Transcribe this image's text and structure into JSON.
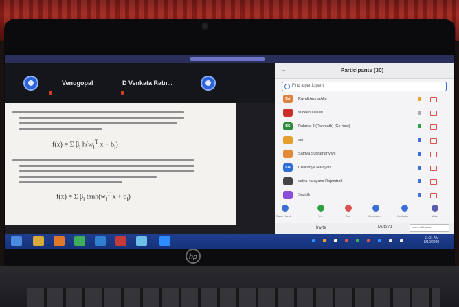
{
  "video_strip": {
    "names": [
      "Venugopal",
      "D Venkata Ratn..."
    ]
  },
  "participants": {
    "title": "Participants (30)",
    "search_placeholder": "Find a participant",
    "rows": [
      {
        "initials": "RA",
        "name": "Ravali Aruna Alla",
        "color": "#e0803a"
      },
      {
        "initials": "",
        "name": "sudeep alasuri",
        "color": "#c9302c"
      },
      {
        "initials": "BC",
        "name": "Rahmat J (Rahmath) (Co-host)",
        "color": "#2e8b3a"
      },
      {
        "initials": "",
        "name": "sai",
        "color": "#e3a02a"
      },
      {
        "initials": "",
        "name": "Sathya Subramanyam",
        "color": "#e08a3a"
      },
      {
        "initials": "CN",
        "name": "Chaitanya Narayan",
        "color": "#2b6fd6"
      },
      {
        "initials": "",
        "name": "satya narayana Rajendrah",
        "color": "#444444"
      },
      {
        "initials": "",
        "name": "Sasidh",
        "color": "#8a4fd8"
      }
    ],
    "toolbar": [
      "Raise Hand",
      "Yes",
      "No",
      "Go slower",
      "Go faster",
      "More"
    ],
    "footer_invite": "Invite",
    "footer_more": "Mute All",
    "footer_tip": "Lower all hands"
  },
  "taskbar": {
    "time": "11:01 AM",
    "date": "8/10/2020"
  },
  "brand": "hp",
  "colors": {
    "wall": "#a0231c",
    "taskbar": "#1f3f8f",
    "accent": "#2b65d9"
  }
}
